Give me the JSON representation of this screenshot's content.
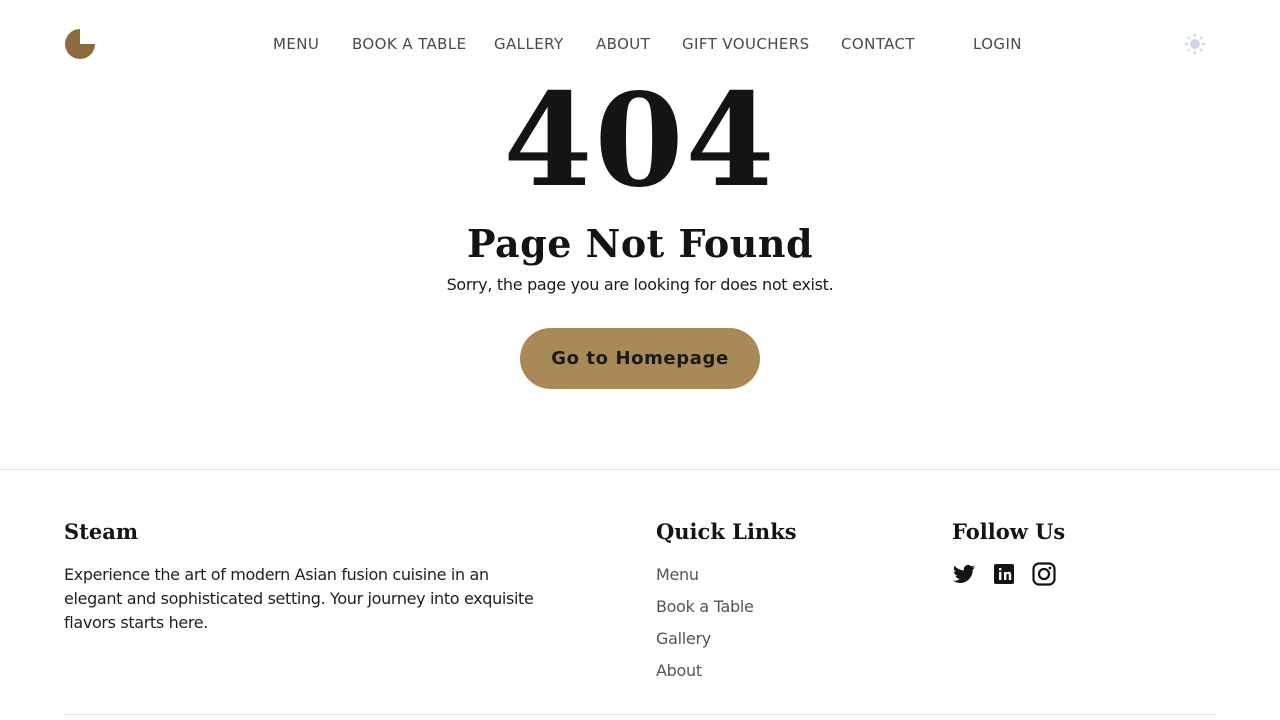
{
  "brand": {
    "accent_color": "#a88957",
    "logo_icon": "quarter-circle-logo-icon"
  },
  "nav": {
    "items": [
      {
        "label": "MENU"
      },
      {
        "label": "BOOK A TABLE"
      },
      {
        "label": "GALLERY"
      },
      {
        "label": "ABOUT"
      },
      {
        "label": "GIFT VOUCHERS"
      },
      {
        "label": "CONTACT"
      },
      {
        "label": "LOGIN"
      }
    ],
    "theme_toggle_icon": "sun-icon"
  },
  "error": {
    "code": "404",
    "title": "Page Not Found",
    "message": "Sorry, the page you are looking for does not exist.",
    "button_label": "Go to Homepage"
  },
  "footer": {
    "brand_title": "Steam",
    "description": "Experience the art of modern Asian fusion cuisine in an elegant and sophisticated setting. Your journey into exquisite flavors starts here.",
    "quick_links_title": "Quick Links",
    "quick_links": [
      {
        "label": "Menu"
      },
      {
        "label": "Book a Table"
      },
      {
        "label": "Gallery"
      },
      {
        "label": "About"
      }
    ],
    "follow_title": "Follow Us",
    "social": [
      {
        "icon": "twitter-icon"
      },
      {
        "icon": "info-icon"
      },
      {
        "icon": "instagram-icon"
      }
    ]
  }
}
